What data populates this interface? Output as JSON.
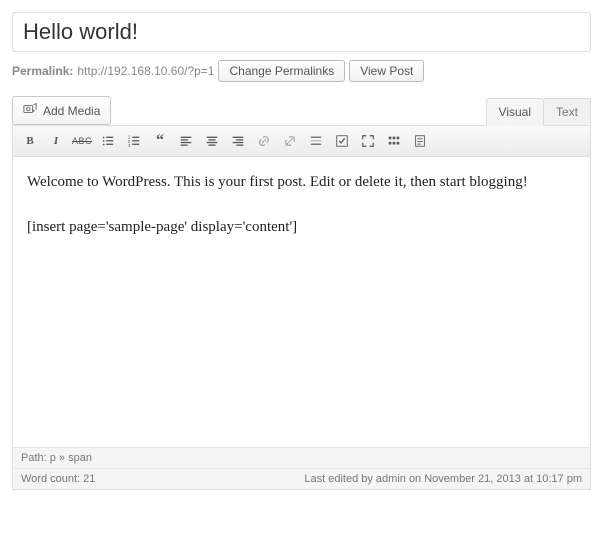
{
  "title": "Hello world!",
  "permalink": {
    "label": "Permalink:",
    "url": "http://192.168.10.60/?p=1",
    "change_btn": "Change Permalinks",
    "view_btn": "View Post"
  },
  "media": {
    "add_btn": "Add Media"
  },
  "tabs": {
    "visual": "Visual",
    "text": "Text"
  },
  "content": {
    "line1": "Welcome to WordPress. This is your first post. Edit or delete it, then start blogging!",
    "line2": "[insert page='sample-page' display='content']"
  },
  "footer": {
    "path_label": "Path:",
    "path_value": "p » span",
    "wc_label": "Word count:",
    "wc_value": "21",
    "last_edit": "Last edited by admin on November 21, 2013 at 10:17 pm"
  }
}
